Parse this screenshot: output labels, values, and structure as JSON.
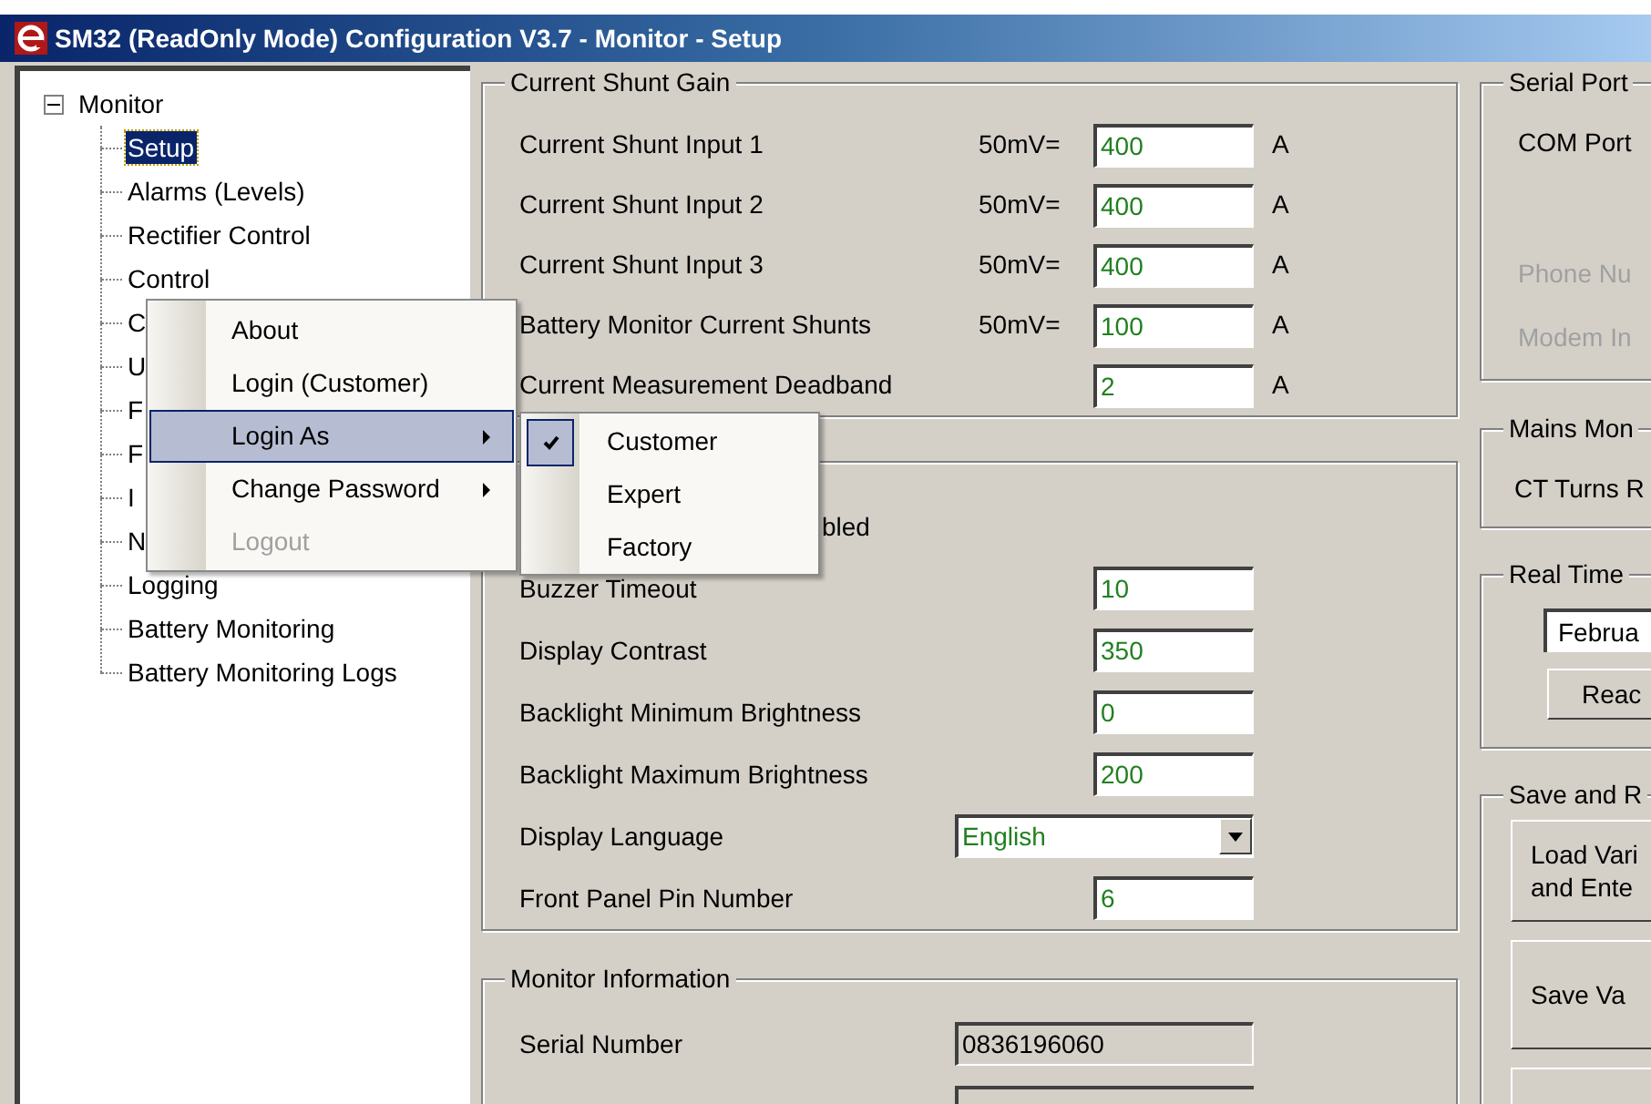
{
  "window": {
    "title": "SM32 (ReadOnly Mode) Configuration V3.7 - Monitor - Setup"
  },
  "tree": {
    "label": "Monitor",
    "expanded": true,
    "children": [
      {
        "label": "Setup",
        "selected": true
      },
      {
        "label": "Alarms (Levels)",
        "selected": false
      },
      {
        "label": "Rectifier Control",
        "selected": false
      },
      {
        "label": "Control",
        "selected": false
      },
      {
        "label": "C",
        "selected": false
      },
      {
        "label": "U",
        "selected": false
      },
      {
        "label": "F",
        "selected": false
      },
      {
        "label": "F",
        "selected": false
      },
      {
        "label": "I",
        "selected": false
      },
      {
        "label": "N",
        "selected": false
      },
      {
        "label": "Logging",
        "selected": false
      },
      {
        "label": "Battery Monitoring",
        "selected": false
      },
      {
        "label": "Battery Monitoring Logs",
        "selected": false
      }
    ]
  },
  "context_menu": {
    "items": [
      {
        "label": "About",
        "submenu": false,
        "selected": false,
        "disabled": false
      },
      {
        "label": "Login (Customer)",
        "submenu": false,
        "selected": false,
        "disabled": false
      },
      {
        "label": "Login As",
        "submenu": true,
        "selected": true,
        "disabled": false
      },
      {
        "label": "Change Password",
        "submenu": true,
        "selected": false,
        "disabled": false
      },
      {
        "label": "Logout",
        "submenu": false,
        "selected": false,
        "disabled": true
      }
    ],
    "submenu": [
      {
        "label": "Customer",
        "checked": true
      },
      {
        "label": "Expert",
        "checked": false
      },
      {
        "label": "Factory",
        "checked": false
      }
    ]
  },
  "shunt_group": {
    "title": "Current Shunt Gain",
    "rows": [
      {
        "label": "Current Shunt Input 1",
        "prefix": "50mV=",
        "value": "400",
        "unit": "A"
      },
      {
        "label": "Current Shunt Input 2",
        "prefix": "50mV=",
        "value": "400",
        "unit": "A"
      },
      {
        "label": "Current Shunt Input 3",
        "prefix": "50mV=",
        "value": "400",
        "unit": "A"
      },
      {
        "label": "Battery Monitor Current Shunts",
        "prefix": "50mV=",
        "value": "100",
        "unit": "A"
      },
      {
        "label": "Current Measurement Deadband",
        "value": "2",
        "unit": "A"
      }
    ]
  },
  "display_group": {
    "partial_label": "bled",
    "rows": [
      {
        "kind": "text",
        "label": "Buzzer Timeout",
        "value": "10"
      },
      {
        "kind": "text",
        "label": "Display Contrast",
        "value": "350"
      },
      {
        "kind": "text",
        "label": "Backlight Minimum Brightness",
        "value": "0"
      },
      {
        "kind": "text",
        "label": "Backlight Maximum Brightness",
        "value": "200"
      },
      {
        "kind": "dropdown",
        "label": "Display Language",
        "value": "English"
      },
      {
        "kind": "text",
        "label": "Front Panel Pin Number",
        "value": "6"
      }
    ]
  },
  "monitor_info": {
    "title": "Monitor Information",
    "rows": [
      {
        "label": "Serial Number",
        "value": "0836196060"
      }
    ]
  },
  "serial_port": {
    "title": "Serial Port",
    "labels": [
      {
        "text": "COM Port",
        "disabled": false
      },
      {
        "text": "Phone Nu",
        "disabled": true
      },
      {
        "text": "Modem In",
        "disabled": true
      }
    ]
  },
  "mains": {
    "title": "Mains Mon",
    "label": "CT Turns R"
  },
  "real_time": {
    "title": "Real Time",
    "field": "Februa",
    "button": "Reac"
  },
  "save_group": {
    "title": "Save and R",
    "buttons": [
      "Load Vari\nand Ente",
      "Save Va"
    ]
  }
}
